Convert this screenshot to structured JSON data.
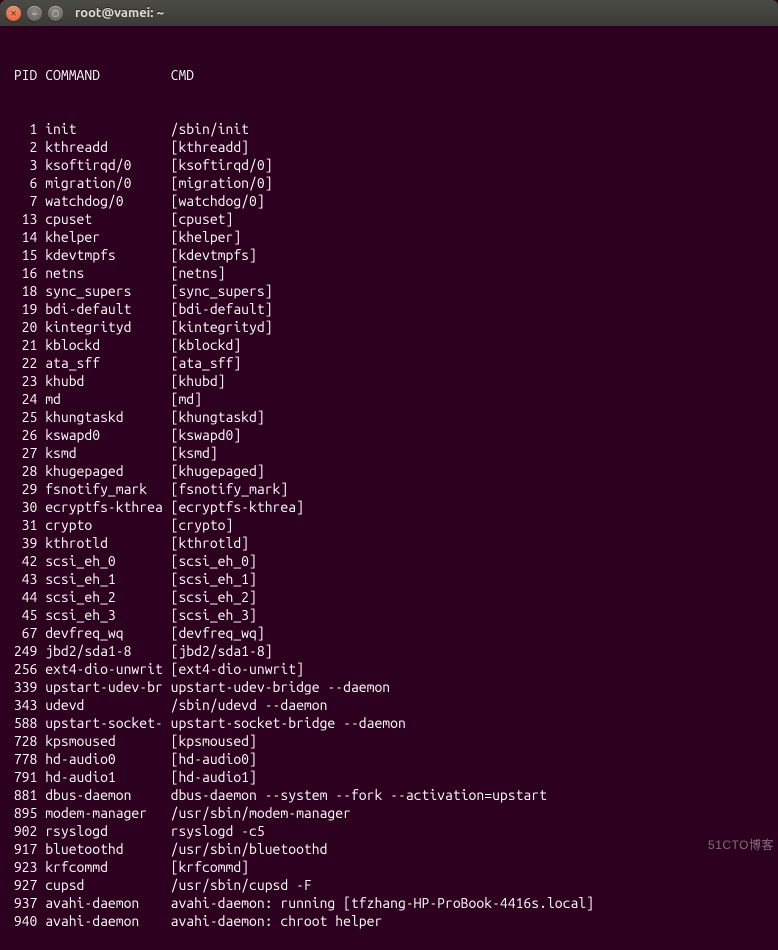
{
  "window": {
    "title": "root@vamei: ~"
  },
  "watermark": "51CTO博客",
  "header": {
    "pid": "PID",
    "command": "COMMAND",
    "cmd": "CMD"
  },
  "processes": [
    {
      "pid": "1",
      "command": "init",
      "cmd": "/sbin/init"
    },
    {
      "pid": "2",
      "command": "kthreadd",
      "cmd": "[kthreadd]"
    },
    {
      "pid": "3",
      "command": "ksoftirqd/0",
      "cmd": "[ksoftirqd/0]"
    },
    {
      "pid": "6",
      "command": "migration/0",
      "cmd": "[migration/0]"
    },
    {
      "pid": "7",
      "command": "watchdog/0",
      "cmd": "[watchdog/0]"
    },
    {
      "pid": "13",
      "command": "cpuset",
      "cmd": "[cpuset]"
    },
    {
      "pid": "14",
      "command": "khelper",
      "cmd": "[khelper]"
    },
    {
      "pid": "15",
      "command": "kdevtmpfs",
      "cmd": "[kdevtmpfs]"
    },
    {
      "pid": "16",
      "command": "netns",
      "cmd": "[netns]"
    },
    {
      "pid": "18",
      "command": "sync_supers",
      "cmd": "[sync_supers]"
    },
    {
      "pid": "19",
      "command": "bdi-default",
      "cmd": "[bdi-default]"
    },
    {
      "pid": "20",
      "command": "kintegrityd",
      "cmd": "[kintegrityd]"
    },
    {
      "pid": "21",
      "command": "kblockd",
      "cmd": "[kblockd]"
    },
    {
      "pid": "22",
      "command": "ata_sff",
      "cmd": "[ata_sff]"
    },
    {
      "pid": "23",
      "command": "khubd",
      "cmd": "[khubd]"
    },
    {
      "pid": "24",
      "command": "md",
      "cmd": "[md]"
    },
    {
      "pid": "25",
      "command": "khungtaskd",
      "cmd": "[khungtaskd]"
    },
    {
      "pid": "26",
      "command": "kswapd0",
      "cmd": "[kswapd0]"
    },
    {
      "pid": "27",
      "command": "ksmd",
      "cmd": "[ksmd]"
    },
    {
      "pid": "28",
      "command": "khugepaged",
      "cmd": "[khugepaged]"
    },
    {
      "pid": "29",
      "command": "fsnotify_mark",
      "cmd": "[fsnotify_mark]"
    },
    {
      "pid": "30",
      "command": "ecryptfs-kthrea",
      "cmd": "[ecryptfs-kthrea]"
    },
    {
      "pid": "31",
      "command": "crypto",
      "cmd": "[crypto]"
    },
    {
      "pid": "39",
      "command": "kthrotld",
      "cmd": "[kthrotld]"
    },
    {
      "pid": "42",
      "command": "scsi_eh_0",
      "cmd": "[scsi_eh_0]"
    },
    {
      "pid": "43",
      "command": "scsi_eh_1",
      "cmd": "[scsi_eh_1]"
    },
    {
      "pid": "44",
      "command": "scsi_eh_2",
      "cmd": "[scsi_eh_2]"
    },
    {
      "pid": "45",
      "command": "scsi_eh_3",
      "cmd": "[scsi_eh_3]"
    },
    {
      "pid": "67",
      "command": "devfreq_wq",
      "cmd": "[devfreq_wq]"
    },
    {
      "pid": "249",
      "command": "jbd2/sda1-8",
      "cmd": "[jbd2/sda1-8]"
    },
    {
      "pid": "256",
      "command": "ext4-dio-unwrit",
      "cmd": "[ext4-dio-unwrit]"
    },
    {
      "pid": "339",
      "command": "upstart-udev-br",
      "cmd": "upstart-udev-bridge --daemon"
    },
    {
      "pid": "343",
      "command": "udevd",
      "cmd": "/sbin/udevd --daemon"
    },
    {
      "pid": "588",
      "command": "upstart-socket-",
      "cmd": "upstart-socket-bridge --daemon"
    },
    {
      "pid": "728",
      "command": "kpsmoused",
      "cmd": "[kpsmoused]"
    },
    {
      "pid": "778",
      "command": "hd-audio0",
      "cmd": "[hd-audio0]"
    },
    {
      "pid": "791",
      "command": "hd-audio1",
      "cmd": "[hd-audio1]"
    },
    {
      "pid": "881",
      "command": "dbus-daemon",
      "cmd": "dbus-daemon --system --fork --activation=upstart"
    },
    {
      "pid": "895",
      "command": "modem-manager",
      "cmd": "/usr/sbin/modem-manager"
    },
    {
      "pid": "902",
      "command": "rsyslogd",
      "cmd": "rsyslogd -c5"
    },
    {
      "pid": "917",
      "command": "bluetoothd",
      "cmd": "/usr/sbin/bluetoothd"
    },
    {
      "pid": "923",
      "command": "krfcommd",
      "cmd": "[krfcommd]"
    },
    {
      "pid": "927",
      "command": "cupsd",
      "cmd": "/usr/sbin/cupsd -F"
    },
    {
      "pid": "937",
      "command": "avahi-daemon",
      "cmd": "avahi-daemon: running [tfzhang-HP-ProBook-4416s.local]"
    },
    {
      "pid": "940",
      "command": "avahi-daemon",
      "cmd": "avahi-daemon: chroot helper"
    }
  ]
}
